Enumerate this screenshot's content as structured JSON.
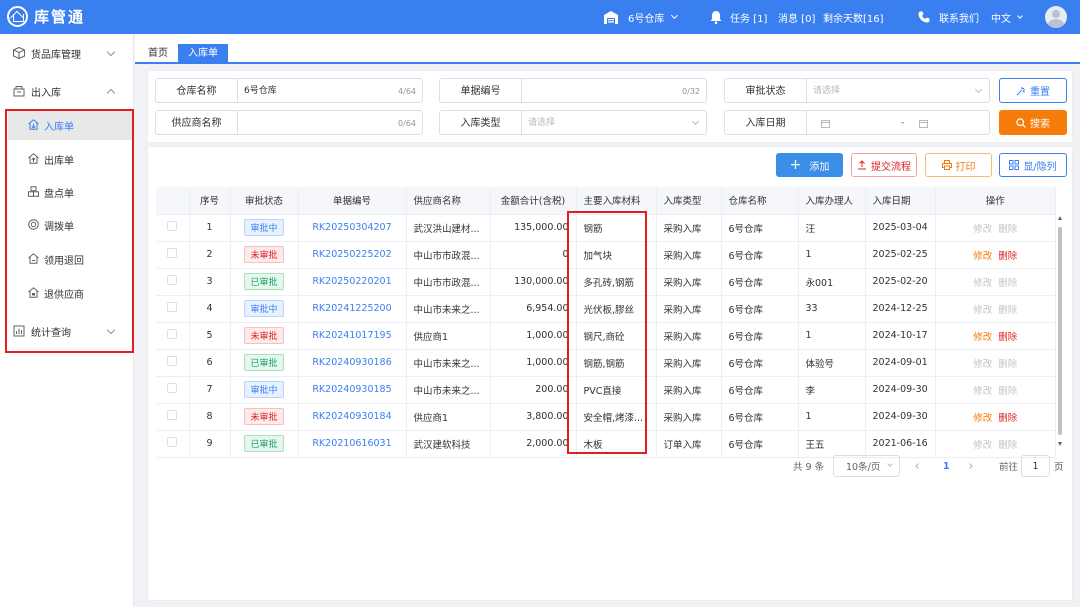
{
  "app": {
    "title": "库管通"
  },
  "topbar": {
    "warehouse": "6号仓库",
    "task": "任务 [1]",
    "message": "消息 [0]",
    "days_left": "剩余天数[16]",
    "contact": "联系我们",
    "language": "中文"
  },
  "sidebar": {
    "goods_mgmt": "货品库管理",
    "inout": "出入库",
    "sub": [
      "入库单",
      "出库单",
      "盘点单",
      "调拨单",
      "领用退回",
      "退供应商"
    ],
    "stats": "统计查询"
  },
  "tabs": [
    "首页",
    "入库单"
  ],
  "filters": {
    "warehouse_label": "仓库名称",
    "warehouse_value": "6号仓库",
    "warehouse_count": "4/64",
    "docno_label": "单据编号",
    "docno_count": "0/32",
    "status_label": "审批状态",
    "status_placeholder": "请选择",
    "supplier_label": "供应商名称",
    "supplier_count": "0/64",
    "type_label": "入库类型",
    "type_placeholder": "请选择",
    "date_label": "入库日期",
    "date_sep": "-",
    "reset": "重置",
    "search": "搜索"
  },
  "actions": {
    "add": "添加",
    "submit": "提交流程",
    "print": "打印",
    "columns": "显/隐列"
  },
  "table": {
    "headers": [
      "序号",
      "审批状态",
      "单据编号",
      "供应商名称",
      "金额合计(含税)",
      "主要入库材料",
      "入库类型",
      "仓库名称",
      "入库办理人",
      "入库日期",
      "操作"
    ],
    "rows": [
      {
        "no": "1",
        "status": "审批中",
        "docno": "RK20250304207",
        "supplier": "武汉洪山建材...",
        "amount": "135,000.00",
        "material": "钢筋",
        "type": "采购入库",
        "warehouse": "6号仓库",
        "handler": "汪",
        "date": "2025-03-04"
      },
      {
        "no": "2",
        "status": "未审批",
        "docno": "RK20250225202",
        "supplier": "中山市市政混...",
        "amount": "0",
        "material": "加气块",
        "type": "采购入库",
        "warehouse": "6号仓库",
        "handler": "1",
        "date": "2025-02-25"
      },
      {
        "no": "3",
        "status": "已审批",
        "docno": "RK20250220201",
        "supplier": "中山市市政混...",
        "amount": "130,000.00",
        "material": "多孔砖,钢筋",
        "type": "采购入库",
        "warehouse": "6号仓库",
        "handler": "永001",
        "date": "2025-02-20"
      },
      {
        "no": "4",
        "status": "审批中",
        "docno": "RK20241225200",
        "supplier": "中山市未来之...",
        "amount": "6,954.00",
        "material": "光伏板,膠丝",
        "type": "采购入库",
        "warehouse": "6号仓库",
        "handler": "33",
        "date": "2024-12-25"
      },
      {
        "no": "5",
        "status": "未审批",
        "docno": "RK20241017195",
        "supplier": "供应商1",
        "amount": "1,000.00",
        "material": "钢尺,商砼",
        "type": "采购入库",
        "warehouse": "6号仓库",
        "handler": "1",
        "date": "2024-10-17"
      },
      {
        "no": "6",
        "status": "已审批",
        "docno": "RK20240930186",
        "supplier": "中山市未来之...",
        "amount": "1,000.00",
        "material": "钢筋,钢筋",
        "type": "采购入库",
        "warehouse": "6号仓库",
        "handler": "体验号",
        "date": "2024-09-01"
      },
      {
        "no": "7",
        "status": "审批中",
        "docno": "RK20240930185",
        "supplier": "中山市未来之...",
        "amount": "200.00",
        "material": "PVC直接",
        "type": "采购入库",
        "warehouse": "6号仓库",
        "handler": "李",
        "date": "2024-09-30"
      },
      {
        "no": "8",
        "status": "未审批",
        "docno": "RK20240930184",
        "supplier": "供应商1",
        "amount": "3,800.00",
        "material": "安全帽,烤漆...",
        "type": "采购入库",
        "warehouse": "6号仓库",
        "handler": "1",
        "date": "2024-09-30"
      },
      {
        "no": "9",
        "status": "已审批",
        "docno": "RK20210616031",
        "supplier": "武汉建软科技",
        "amount": "2,000.00",
        "material": "木板",
        "type": "订单入库",
        "warehouse": "6号仓库",
        "handler": "王五",
        "date": "2021-06-16"
      }
    ],
    "edit": "修改",
    "delete": "删除"
  },
  "pager": {
    "total": "共 9 条",
    "size": "10条/页",
    "page": "1",
    "goto": "前往",
    "goto_value": "1",
    "page_unit": "页"
  },
  "colors": {
    "primary": "#3a7ff0",
    "orange": "#f57b0a",
    "red": "#e02020",
    "green": "#19a15f"
  }
}
